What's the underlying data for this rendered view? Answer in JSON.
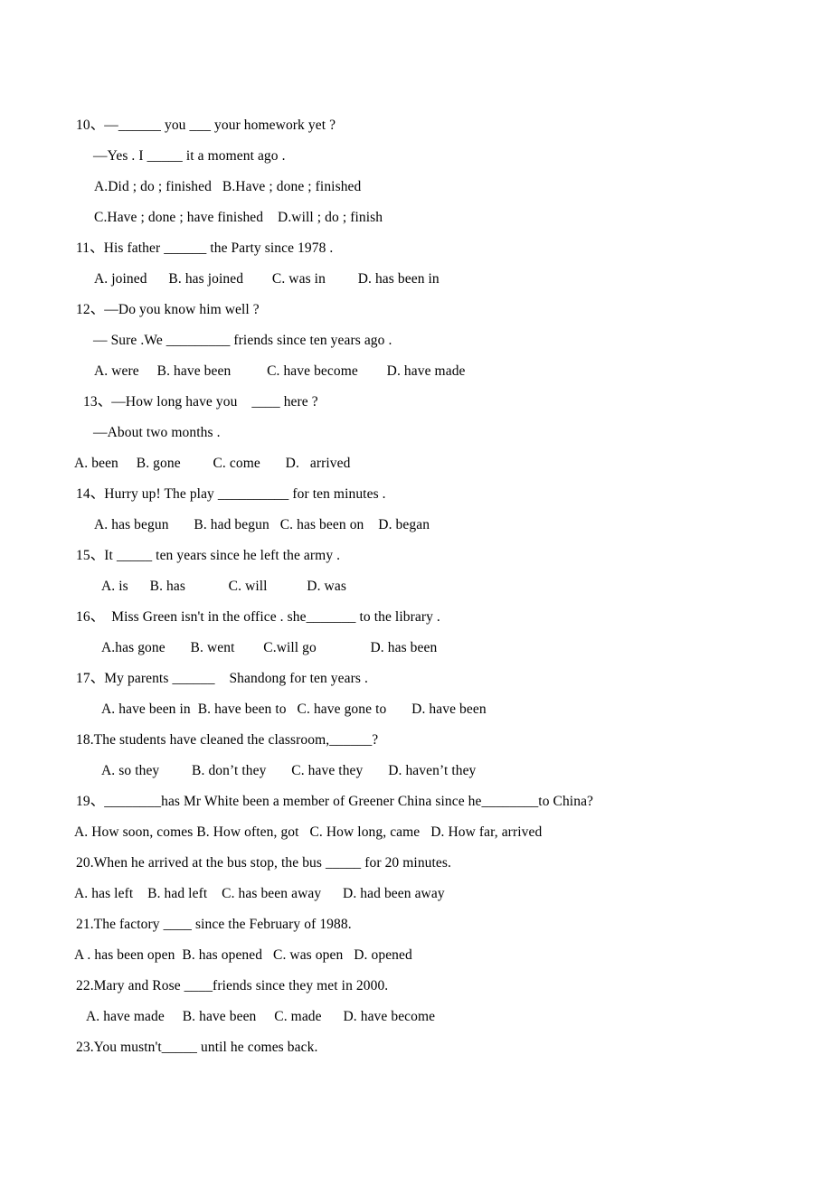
{
  "document": {
    "background_color": "#ffffff",
    "text_color": "#000000",
    "lines": [
      {
        "id": "q10-stem",
        "text": "10、—______ you ___ your homework yet ?"
      },
      {
        "id": "q10-reply",
        "text": "—Yes . I _____ it a moment ago ."
      },
      {
        "id": "q10-optsAB",
        "text": "A.Did ; do ; finished   B.Have ; done ; finished"
      },
      {
        "id": "q10-optsCD",
        "text": "C.Have ; done ; have finished    D.will ; do ; finish"
      },
      {
        "id": "q11-stem",
        "text": "11、His father ______ the Party since 1978 ."
      },
      {
        "id": "q11-opts",
        "text": "A. joined      B. has joined        C. was in         D. has been in"
      },
      {
        "id": "q12-stem",
        "text": "12、—Do you know him well ?"
      },
      {
        "id": "q12-reply",
        "text": "— Sure .We _________ friends since ten years ago ."
      },
      {
        "id": "q12-opts",
        "text": "A. were     B. have been          C. have become        D. have made"
      },
      {
        "id": "q13-stem",
        "text": "13、—How long have you    ____ here ?"
      },
      {
        "id": "q13-reply",
        "text": "—About two months ."
      },
      {
        "id": "q13-opts",
        "text": "A. been     B. gone         C. come       D.   arrived"
      },
      {
        "id": "q14-stem",
        "text": "14、Hurry up! The play __________ for ten minutes ."
      },
      {
        "id": "q14-opts",
        "text": "A. has begun       B. had begun   C. has been on    D. began"
      },
      {
        "id": "q15-stem",
        "text": "15、It _____ ten years since he left the army ."
      },
      {
        "id": "q15-opts",
        "text": "A. is      B. has            C. will           D. was"
      },
      {
        "id": "q16-stem",
        "text": "16、  Miss Green isn't in the office . she_______ to the library ."
      },
      {
        "id": "q16-opts",
        "text": "A.has gone       B. went        C.will go               D. has been"
      },
      {
        "id": "q17-stem",
        "text": "17、My parents ______    Shandong for ten years ."
      },
      {
        "id": "q17-opts",
        "text": "A. have been in  B. have been to   C. have gone to       D. have been"
      },
      {
        "id": "q18-stem",
        "text": "18.The students have cleaned the classroom,______?"
      },
      {
        "id": "q18-opts",
        "text": "A. so they         B. don’t they       C. have they       D. haven’t they"
      },
      {
        "id": "q19-stem",
        "text": "19、________has Mr White been a member of Greener China since he________to China?"
      },
      {
        "id": "q19-opts",
        "text": "A. How soon, comes B. How often, got   C. How long, came   D. How far, arrived"
      },
      {
        "id": "q20-stem",
        "text": "20.When he arrived at the bus stop, the bus _____ for 20 minutes."
      },
      {
        "id": "q20-opts",
        "text": "A. has left    B. had left    C. has been away      D. had been away"
      },
      {
        "id": "q21-stem",
        "text": "21.The factory ____ since the February of 1988."
      },
      {
        "id": "q21-opts",
        "text": "A . has been open  B. has opened   C. was open   D. opened"
      },
      {
        "id": "q22-stem",
        "text": "22.Mary and Rose ____friends since they met in 2000."
      },
      {
        "id": "q22-opts",
        "text": "A. have made     B. have been     C. made      D. have become"
      },
      {
        "id": "q23-stem",
        "text": "23.You mustn't_____ until he comes back."
      }
    ]
  }
}
